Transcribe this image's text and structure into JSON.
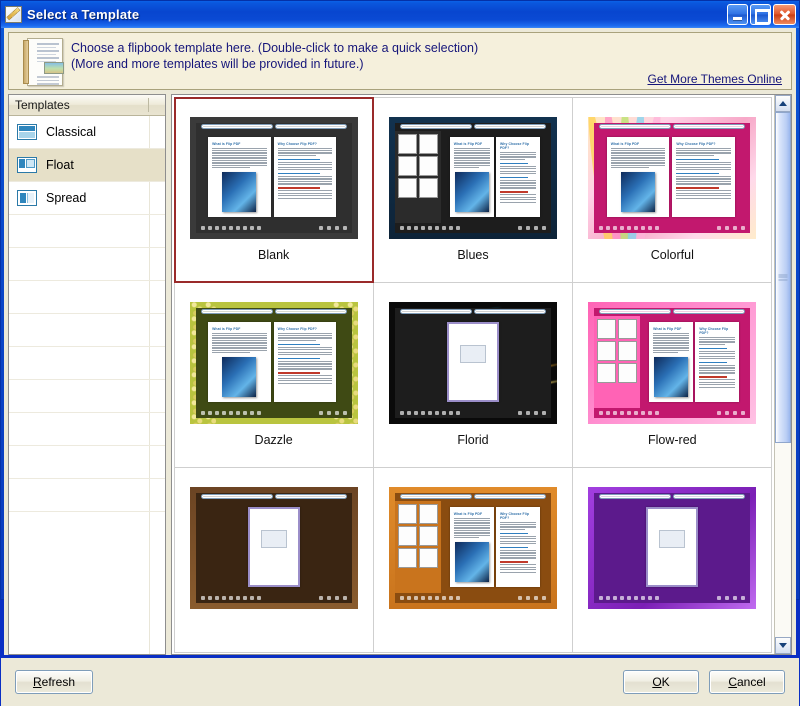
{
  "window": {
    "title": "Select a Template",
    "title_icon": "template-pencil-icon",
    "buttons": {
      "minimize": "minimize-icon",
      "maximize": "maximize-icon",
      "close": "close-icon"
    }
  },
  "info": {
    "icon": "document-page-icon",
    "line1": "Choose a flipbook template here. (Double-click to make a quick selection)",
    "line2": "(More and more templates will be provided in future.)",
    "link": "Get More Themes Online"
  },
  "sidebar": {
    "column_header": "Templates",
    "items": [
      {
        "label": "Classical",
        "icon": "layout-classical-icon",
        "selected": false
      },
      {
        "label": "Float",
        "icon": "layout-float-icon",
        "selected": true
      },
      {
        "label": "Spread",
        "icon": "layout-spread-icon",
        "selected": false
      }
    ],
    "empty_row_count": 9
  },
  "templates": {
    "selected": "Blank",
    "items": [
      {
        "label": "Blank",
        "style": "t-blank",
        "layout": "single",
        "selected": true
      },
      {
        "label": "Blues",
        "style": "t-blues",
        "layout": "sidebar",
        "selected": false
      },
      {
        "label": "Colorful",
        "style": "t-colorful",
        "layout": "single",
        "selected": false
      },
      {
        "label": "Dazzle",
        "style": "t-dazzle",
        "layout": "single",
        "selected": false
      },
      {
        "label": "Florid",
        "style": "t-florid",
        "layout": "cover",
        "selected": false
      },
      {
        "label": "Flow-red",
        "style": "t-flowred",
        "layout": "sidebar",
        "selected": false
      },
      {
        "label": "",
        "style": "t-wood",
        "layout": "cover",
        "selected": false
      },
      {
        "label": "",
        "style": "t-orange",
        "layout": "sidebar",
        "selected": false
      },
      {
        "label": "",
        "style": "t-purple",
        "layout": "cover",
        "selected": false
      }
    ]
  },
  "scrollbar": {
    "up": "chevron-up-icon",
    "down": "chevron-down-icon",
    "thumb_position_percent": 0,
    "thumb_size_percent": 63
  },
  "footer": {
    "refresh": {
      "accel": "R",
      "rest": "efresh"
    },
    "ok": {
      "accel": "O",
      "rest": "K"
    },
    "cancel": {
      "accel": "C",
      "rest": "ancel"
    }
  },
  "colors": {
    "title_blue": "#0a4ad4",
    "info_bg": "#f5f0dc",
    "dialog_bg": "#ece9d8",
    "selection_red": "#9a2a2a",
    "sidebar_selected": "#e6e0c8",
    "link_text": "#15157a"
  }
}
